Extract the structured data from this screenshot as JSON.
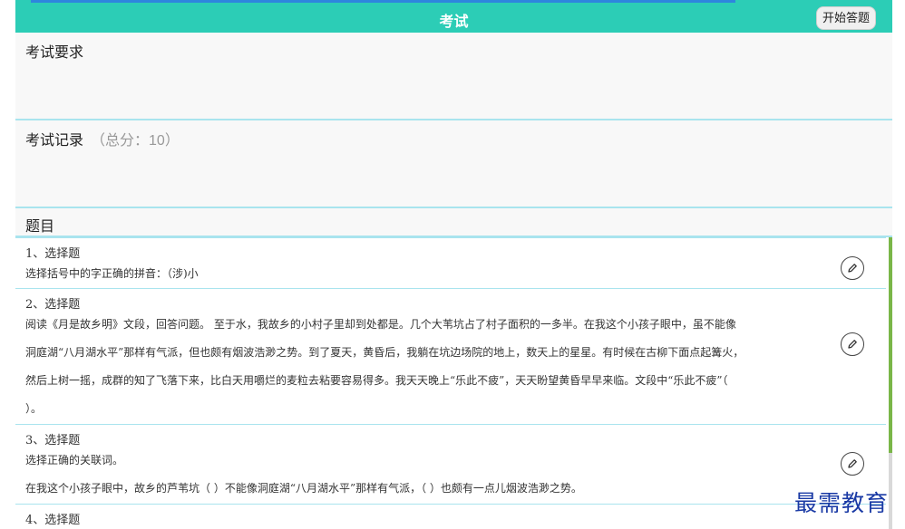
{
  "header": {
    "title": "考试",
    "start_button": "开始答题"
  },
  "requirements": {
    "label": "考试要求"
  },
  "records": {
    "label": "考试记录",
    "total": "（总分：10）"
  },
  "questions_header": {
    "label": "题目"
  },
  "questions": [
    {
      "title": "1、选择题",
      "lines": [
        "选择括号中的字正确的拼音：（涉)小"
      ]
    },
    {
      "title": "2、选择题",
      "lines": [
        "阅读《月是故乡明》文段，回答问题。    至于水，我故乡的小村子里却到处都是。几个大苇坑占了村子面积的一多半。在我这个小孩子眼中，虽不能像",
        "洞庭湖“八月湖水平”那样有气派，但也颇有烟波浩渺之势。到了夏天，黄昏后，我躺在坑边场院的地上，数天上的星星。有时候在古柳下面点起篝火，",
        "然后上树一摇，成群的知了飞落下来，比白天用嚼烂的麦粒去粘要容易得多。我天天晚上“乐此不疲”，天天盼望黄昏早早来临。文段中“乐此不疲”（",
        "）。"
      ]
    },
    {
      "title": "3、选择题",
      "lines": [
        "选择正确的关联词。",
        "在我这个小孩子眼中，故乡的芦苇坑（    ）不能像洞庭湖“八月湖水平”那样有气派，（    ）也颇有一点儿烟波浩渺之势。"
      ]
    },
    {
      "title": "4、选择题",
      "lines": []
    }
  ],
  "icons": {
    "edit": "edit-pencil-icon"
  },
  "watermark": "最需教育",
  "colors": {
    "header": "#2ccdb6",
    "divider": "#a9e4ee",
    "scroll_thumb": "#7ab648",
    "watermark": "#1a3aa5"
  }
}
